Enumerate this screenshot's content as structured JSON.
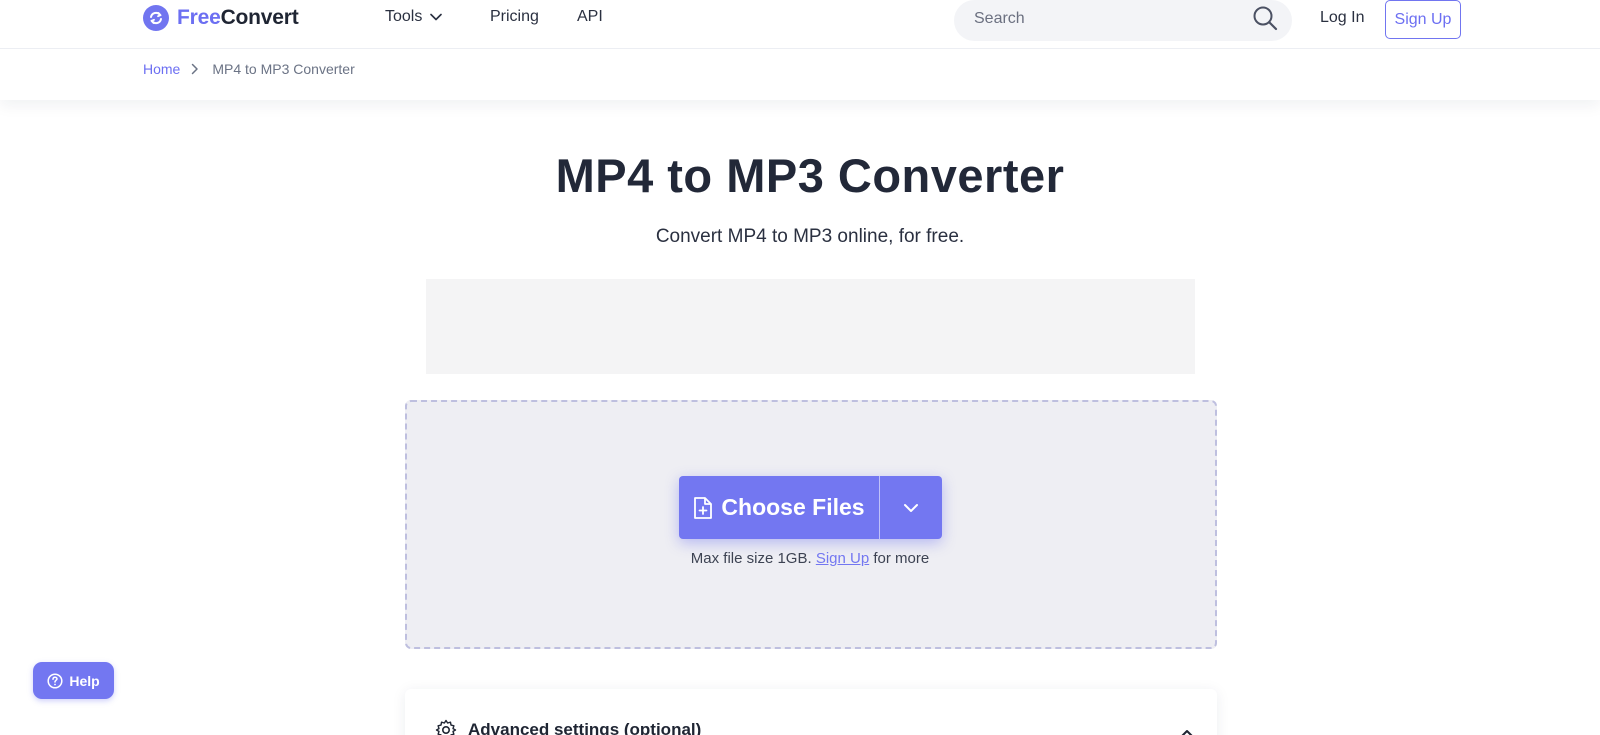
{
  "brand": {
    "part1": "Free",
    "part2": "Convert",
    "accent": "#7175f0"
  },
  "nav": {
    "tools": "Tools",
    "pricing": "Pricing",
    "api": "API"
  },
  "search": {
    "placeholder": "Search"
  },
  "auth": {
    "login": "Log In",
    "signup": "Sign Up"
  },
  "breadcrumb": {
    "home": "Home",
    "current": "MP4 to MP3 Converter"
  },
  "main": {
    "title": "MP4 to MP3 Converter",
    "subtitle": "Convert MP4 to MP3 online, for free."
  },
  "upload": {
    "choose_label": "Choose Files",
    "max_prefix": "Max file size 1GB.",
    "max_link": "Sign Up",
    "max_suffix": "for more"
  },
  "help": {
    "label": "Help"
  },
  "advanced": {
    "label": "Advanced settings (optional)"
  }
}
